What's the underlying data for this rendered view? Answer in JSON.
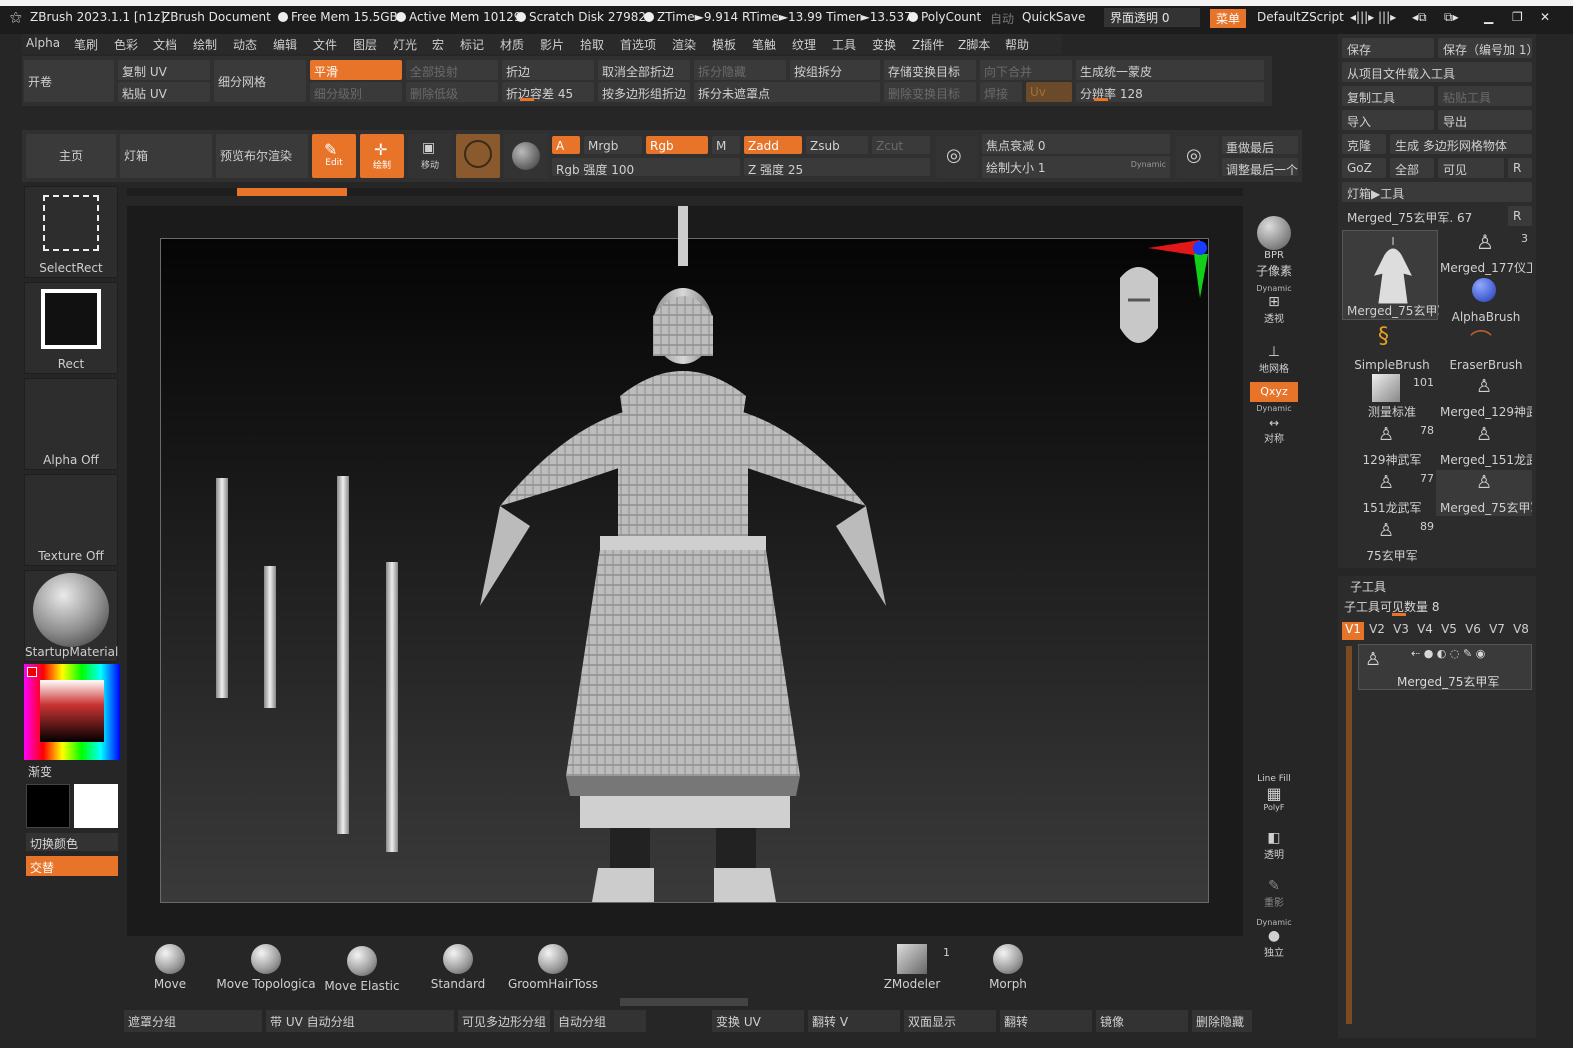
{
  "title": {
    "app": "ZBrush 2023.1.1 [n1z]",
    "doc": "ZBrush Document",
    "free_mem": "Free Mem 15.5GB",
    "active_mem": "Active Mem 10129",
    "scratch": "Scratch Disk 27982",
    "ztime": "ZTime►9.914 RTime►13.99 Timer►13.537",
    "polycount": "PolyCount",
    "auto": "自动",
    "quicksave": "QuickSave",
    "ui_opacity": "界面透明 0",
    "menu": "菜单",
    "script": "DefaultZScript"
  },
  "menu": [
    "Alpha",
    "笔刷",
    "色彩",
    "文档",
    "绘制",
    "动态",
    "编辑",
    "文件",
    "图层",
    "灯光",
    "宏",
    "标记",
    "材质",
    "影片",
    "拾取",
    "首选项",
    "渲染",
    "模板",
    "笔触",
    "纹理",
    "工具",
    "变换",
    "Z插件",
    "Z脚本",
    "帮助"
  ],
  "top_tools": {
    "open_scroll": "开卷",
    "copy_uv": "复制 UV",
    "paste_uv": "粘贴 UV",
    "subdivide": "细分网格",
    "smooth": "平滑",
    "subdiv_level": "细分级别",
    "project_all": "全部投射",
    "delete_lower": "删除低级",
    "crease": "折边",
    "crease_tol": "折边容差 45",
    "uncrease_all": "取消全部折边",
    "crease_by_poly": "按多边形组折边",
    "split_hidden": "拆分隐藏",
    "split_unmasked": "拆分未遮罩点",
    "split_groups": "按组拆分",
    "store_morph": "存储变换目标",
    "delete_morph": "删除变换目标",
    "merge_down": "向下合并",
    "weld": "焊接",
    "uv": "Uv",
    "dynamesh": "生成统一蒙皮",
    "resolution": "分辨率 128"
  },
  "tool_row": {
    "home": "主页",
    "lightbox": "灯箱",
    "preview_bool": "预览布尔渲染",
    "edit": "Edit",
    "draw": "绘制",
    "move": "移动",
    "a": "A",
    "mrgb": "Mrgb",
    "rgb": "Rgb",
    "m": "M",
    "zadd": "Zadd",
    "zsub": "Zsub",
    "zcut": "Zcut",
    "rgb_intensity": "Rgb 强度 100",
    "z_intensity": "Z 强度 25",
    "focal_shift": "焦点衰减 0",
    "draw_size": "绘制大小 1",
    "dynamic": "Dynamic",
    "replay_last": "重做最后",
    "replay_rel": "调整最后一个"
  },
  "left": {
    "select_rect": "SelectRect",
    "rect": "Rect",
    "alpha_off": "Alpha Off",
    "texture_off": "Texture Off",
    "material": "StartupMaterial",
    "gradient": "渐变",
    "switch_color": "切换颜色",
    "alternate": "交替"
  },
  "right": {
    "save": "保存",
    "save_inc": "保存（编号加 1）",
    "load_project": "从项目文件载入工具",
    "copy_tool": "复制工具",
    "paste_tool": "粘贴工具",
    "import": "导入",
    "export": "导出",
    "clone": "克隆",
    "make_polymesh": "生成 多边形网格物体",
    "goz": "GoZ",
    "all": "全部",
    "visible": "可见",
    "r": "R",
    "lightbox_tools": "灯箱▶工具",
    "current_tool": "Merged_75玄甲军. 67",
    "thumbs": [
      {
        "name": "Merged_75玄甲军",
        "count": ""
      },
      {
        "name": "Merged_177仪卫",
        "count": "3"
      },
      {
        "name": "AlphaBrush",
        "count": ""
      },
      {
        "name": "SimpleBrush",
        "count": ""
      },
      {
        "name": "EraserBrush",
        "count": ""
      },
      {
        "name": "测量标准",
        "count": "101"
      },
      {
        "name": "Merged_129神武",
        "count": ""
      },
      {
        "name": "129神武军",
        "count": "78"
      },
      {
        "name": "Merged_151龙武",
        "count": ""
      },
      {
        "name": "151龙武军",
        "count": "77"
      },
      {
        "name": "Merged_75玄甲军",
        "count": ""
      },
      {
        "name": "75玄甲军",
        "count": "89"
      }
    ],
    "subtool_title": "子工具",
    "subtool_visible": "子工具可见数量 8",
    "vtabs": [
      "V1",
      "V2",
      "V3",
      "V4",
      "V5",
      "V6",
      "V7",
      "V8"
    ],
    "subtool_item": "Merged_75玄甲军"
  },
  "shelf": {
    "bpr": "BPR",
    "subpixel": "子像素",
    "dynamic": "Dynamic",
    "persp": "透视",
    "floor": "地网格",
    "xyz": "Qxyz",
    "sym": "对称",
    "linefill": "Line Fill",
    "polyf": "PolyF",
    "transp": "透明",
    "ghost": "重影",
    "solo": "独立"
  },
  "brushes": [
    {
      "label": "Move"
    },
    {
      "label": "Move Topologica"
    },
    {
      "label": "Move Elastic"
    },
    {
      "label": "Standard"
    },
    {
      "label": "GroomHairToss"
    },
    {
      "label": "ZModeler",
      "count": "1"
    },
    {
      "label": "Morph"
    }
  ],
  "bottom": [
    "遮罩分组",
    "带 UV 自动分组",
    "可见多边形分组",
    "自动分组",
    "变换 UV",
    "翻转 V",
    "双面显示",
    "翻转",
    "镜像",
    "删除隐藏"
  ],
  "colors": {
    "accent": "#e8742a",
    "bg": "#262626",
    "panel": "#303030"
  }
}
